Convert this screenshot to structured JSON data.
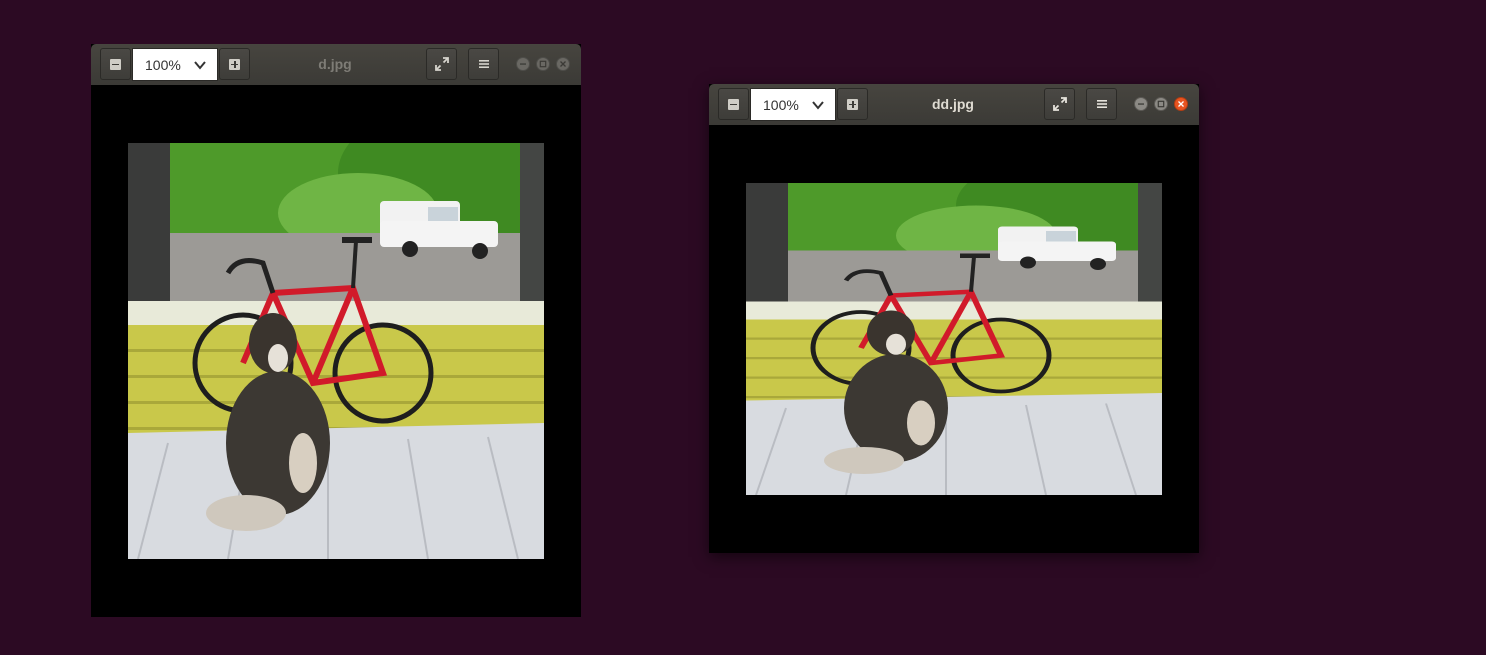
{
  "windows": [
    {
      "title": "d.jpg",
      "zoom": "100%",
      "active": false
    },
    {
      "title": "dd.jpg",
      "zoom": "100%",
      "active": true
    }
  ],
  "icons": {
    "zoom_out": "zoom-out-icon",
    "zoom_in": "zoom-in-icon",
    "dropdown": "chevron-down-icon",
    "fullscreen": "fullscreen-icon",
    "menu": "hamburger-menu-icon",
    "minimize": "minimize-icon",
    "maximize": "maximize-icon",
    "close": "close-icon"
  },
  "colors": {
    "desktop": "#2c0a23",
    "headerbar": "#3b3a36",
    "close_active": "#e95420"
  }
}
